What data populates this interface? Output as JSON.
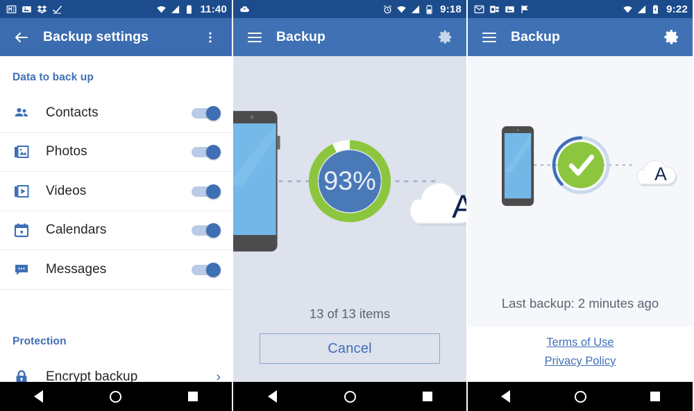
{
  "meta": {
    "accent_blue": "#3f6fb5",
    "appbar_blue": "#3c6cb0",
    "statusbar_blue": "#1c4c8c",
    "green": "#8cc63e",
    "panel2_bg": "#dde2ed",
    "panel3_bg": "#f5f7fb"
  },
  "panel1": {
    "statusbar": {
      "time": "11:40",
      "left_icons": [
        "gmail-icon",
        "photos-icon",
        "dropbox-icon",
        "checkmark-icon"
      ],
      "right_icons": [
        "wifi-icon",
        "signal-icon",
        "battery-icon"
      ]
    },
    "appbar": {
      "back_icon": "back-arrow-icon",
      "title": "Backup settings",
      "overflow_icon": "overflow-menu-icon"
    },
    "sections": [
      {
        "header": "Data to back up",
        "rows": [
          {
            "icon": "contacts-icon",
            "label": "Contacts",
            "control": "toggle",
            "value": "on"
          },
          {
            "icon": "photos-icon",
            "label": "Photos",
            "control": "toggle",
            "value": "on"
          },
          {
            "icon": "videos-icon",
            "label": "Videos",
            "control": "toggle",
            "value": "on"
          },
          {
            "icon": "calendar-icon",
            "label": "Calendars",
            "control": "toggle",
            "value": "on"
          },
          {
            "icon": "messages-icon",
            "label": "Messages",
            "control": "toggle",
            "value": "on"
          }
        ]
      },
      {
        "header": "Protection",
        "rows": [
          {
            "icon": "lock-icon",
            "label": "Encrypt backup",
            "control": "chevron",
            "value": "›"
          }
        ]
      }
    ]
  },
  "panel2": {
    "statusbar": {
      "time": "9:18",
      "left_icons": [
        "cloud-upload-icon"
      ],
      "right_icons": [
        "alarm-icon",
        "wifi-icon",
        "signal-icon",
        "battery-icon"
      ]
    },
    "appbar": {
      "menu_icon": "hamburger-menu-icon",
      "title": "Backup",
      "settings_icon": "gear-icon"
    },
    "progress": {
      "percent_label": "93%",
      "percent_value": 93,
      "ring_color": "#8cc63e",
      "fill_color": "#4a79b8"
    },
    "illustration": {
      "device": "phone-icon",
      "cloud_logo_letter": "A"
    },
    "items_count": "13 of 13 items",
    "cancel_label": "Cancel"
  },
  "panel3": {
    "statusbar": {
      "time": "9:22",
      "left_icons": [
        "gmail-icon",
        "outlook-icon",
        "photos-icon",
        "flag-icon"
      ],
      "right_icons": [
        "wifi-icon",
        "signal-icon",
        "battery-charging-icon"
      ]
    },
    "appbar": {
      "menu_icon": "hamburger-menu-icon",
      "title": "Backup",
      "settings_icon": "gear-icon"
    },
    "illustration": {
      "device": "phone-icon",
      "status": "success-check-icon",
      "cloud_logo_letter": "A"
    },
    "last_backup": "Last backup: 2 minutes ago",
    "links": [
      {
        "label": "Terms of Use"
      },
      {
        "label": "Privacy Policy"
      }
    ]
  },
  "navbar": {
    "back": "back-triangle-icon",
    "home": "home-circle-icon",
    "recents": "recents-square-icon"
  }
}
